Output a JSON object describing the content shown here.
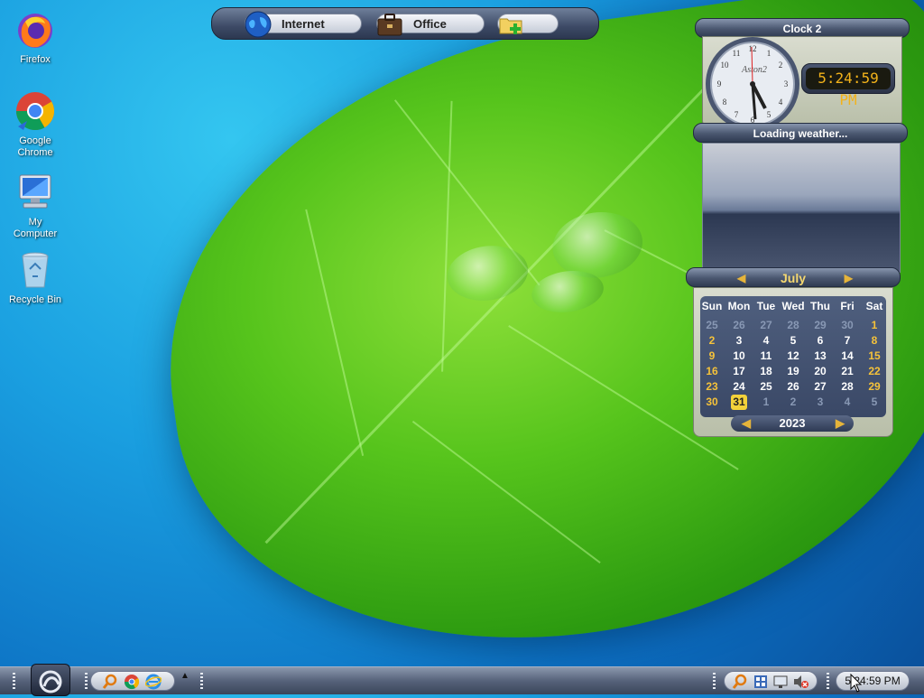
{
  "desktop": {
    "icons": [
      {
        "label": "Firefox"
      },
      {
        "label": "Google Chrome"
      },
      {
        "label": "My Computer"
      },
      {
        "label": "Recycle Bin"
      }
    ]
  },
  "launcher": {
    "buttons": [
      {
        "label": "Internet",
        "icon": "globe-icon"
      },
      {
        "label": "Office",
        "icon": "briefcase-icon"
      },
      {
        "label": "",
        "icon": "add-folder-icon"
      }
    ]
  },
  "clock_widget": {
    "title": "Clock 2",
    "face_brand": "Aston2",
    "digital_time": "5:24:59 PM"
  },
  "weather_widget": {
    "status": "Loading weather..."
  },
  "calendar_widget": {
    "month": "July",
    "year": "2023",
    "weekdays": [
      "Sun",
      "Mon",
      "Tue",
      "Wed",
      "Thu",
      "Fri",
      "Sat"
    ],
    "weeks": [
      [
        "25",
        "26",
        "27",
        "28",
        "29",
        "30",
        "1"
      ],
      [
        "2",
        "3",
        "4",
        "5",
        "6",
        "7",
        "8"
      ],
      [
        "9",
        "10",
        "11",
        "12",
        "13",
        "14",
        "15"
      ],
      [
        "16",
        "17",
        "18",
        "19",
        "20",
        "21",
        "22"
      ],
      [
        "23",
        "24",
        "25",
        "26",
        "27",
        "28",
        "29"
      ],
      [
        "30",
        "31",
        "1",
        "2",
        "3",
        "4",
        "5"
      ]
    ],
    "today": "31"
  },
  "taskbar": {
    "quick_launch": [
      "search-icon",
      "chrome-icon",
      "ie-icon"
    ],
    "tray_icons": [
      "search-icon",
      "network-icon",
      "monitor-icon",
      "mute-icon"
    ],
    "clock": "5:24:59 PM"
  }
}
